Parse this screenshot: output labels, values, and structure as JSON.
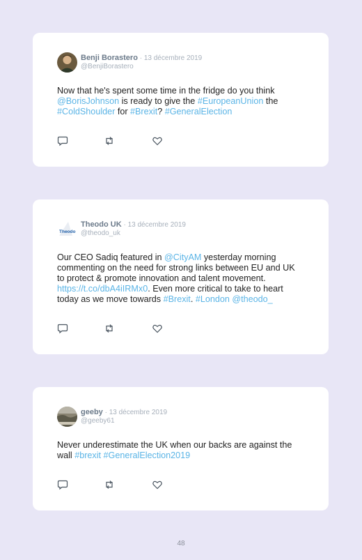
{
  "page_number": "48",
  "tweets": [
    {
      "name": "Benji Borastero",
      "sep": " · ",
      "date": "13 décembre 2019",
      "handle": "@BenjiBorastero",
      "avatar_icon": "user-photo-avatar",
      "segments": [
        {
          "t": "Now that he's spent some time in the fridge do you think "
        },
        {
          "t": "@BorisJohnson",
          "link": true
        },
        {
          "t": " is ready to give the "
        },
        {
          "t": "#EuropeanUnion",
          "link": true
        },
        {
          "t": " the "
        },
        {
          "t": "#ColdShoulder",
          "link": true
        },
        {
          "t": " for "
        },
        {
          "t": "#Brexit",
          "link": true
        },
        {
          "t": "? "
        },
        {
          "t": "#GeneralElection",
          "link": true
        }
      ]
    },
    {
      "name": "Theodo UK",
      "sep": " · ",
      "date": "13 décembre 2019",
      "handle": "@theodo_uk",
      "avatar_icon": "theodo-logo-avatar",
      "avatar_text": "Theodo",
      "segments": [
        {
          "t": "Our CEO Sadiq featured in "
        },
        {
          "t": "@CityAM",
          "link": true
        },
        {
          "t": " yesterday morning commenting on the need for strong links between EU and UK to protect & promote innovation and talent movement. "
        },
        {
          "t": "https://t.co/dbA4iIRMx0",
          "link": true
        },
        {
          "t": ". Even more critical to take to heart today as we move towards "
        },
        {
          "t": "#Brexit",
          "link": true
        },
        {
          "t": ". "
        },
        {
          "t": "#London",
          "link": true
        },
        {
          "t": " "
        },
        {
          "t": "@theodo_",
          "link": true
        }
      ]
    },
    {
      "name": "geeby",
      "sep": " · ",
      "date": "13 décembre 2019",
      "handle": "@geeby61",
      "avatar_icon": "landscape-photo-avatar",
      "segments": [
        {
          "t": "Never underestimate the UK when our backs are against the wall "
        },
        {
          "t": "#brexit",
          "link": true
        },
        {
          "t": " "
        },
        {
          "t": "#GeneralElection2019",
          "link": true
        }
      ]
    }
  ],
  "colors": {
    "background": "#e8e6f6",
    "link": "#5ab4e6",
    "icon": "#4a5560"
  },
  "action_icons": [
    "reply-icon",
    "retweet-icon",
    "like-icon"
  ]
}
